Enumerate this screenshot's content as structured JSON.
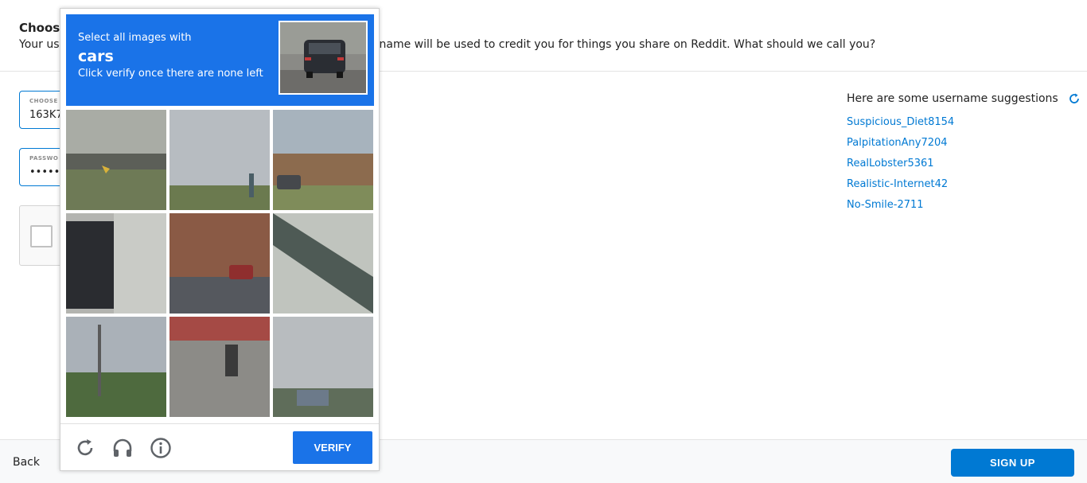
{
  "header": {
    "title": "Choos",
    "subtitle_left": "Your us",
    "subtitle_right": "name will be used to credit you for things you share on Reddit. What should we call you?"
  },
  "form": {
    "username": {
      "label": "CHOOSE",
      "value": "163K7"
    },
    "password": {
      "label": "PASSWO",
      "value": "••••••••"
    }
  },
  "suggestions": {
    "heading": "Here are some username suggestions",
    "refresh_icon": "refresh-icon",
    "items": [
      "Suspicious_Diet8154",
      "PalpitationAny7204",
      "RealLobster5361",
      "Realistic-Internet42",
      "No-Smile-2711"
    ]
  },
  "footer": {
    "back_label": "Back",
    "signup_label": "SIGN UP"
  },
  "captcha": {
    "instruction": "Select all images with",
    "target_word": "cars",
    "hint": "Click verify once there are none left",
    "verify_label": "VERIFY",
    "icons": [
      "reload-icon",
      "headphones-icon",
      "info-icon"
    ]
  },
  "colors": {
    "reddit_blue": "#0079d3",
    "captcha_blue": "#1a73e8"
  }
}
